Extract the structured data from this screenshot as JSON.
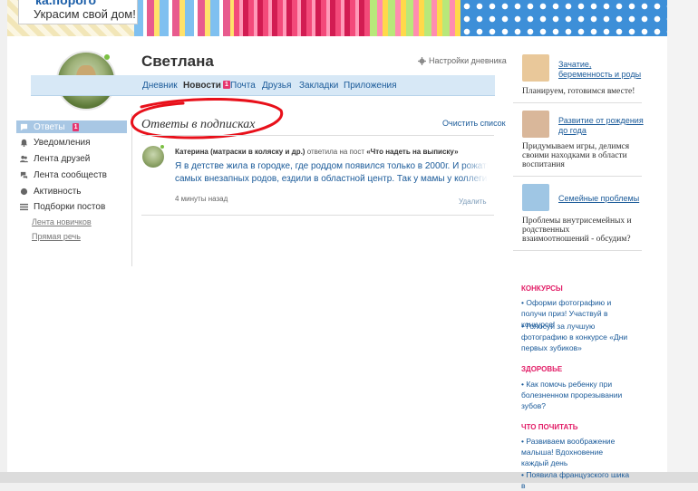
{
  "header": {
    "logo_top": "ка.порого",
    "slogan": "Украсим свой дом!"
  },
  "user": {
    "name": "Светлана",
    "settings_label": "Настройки дневника"
  },
  "tabs": [
    {
      "label": "Дневник",
      "active": false
    },
    {
      "label": "Новости",
      "active": true,
      "badge": "1"
    },
    {
      "label": "Почта",
      "active": false
    },
    {
      "label": "Друзья",
      "active": false
    },
    {
      "label": "Закладки",
      "active": false
    },
    {
      "label": "Приложения",
      "active": false
    }
  ],
  "sidebar": {
    "items": [
      {
        "label": "Ответы",
        "badge": "1",
        "icon": "speech-bubble-icon",
        "active": true
      },
      {
        "label": "Уведомления",
        "icon": "bell-icon"
      },
      {
        "label": "Лента друзей",
        "icon": "people-icon"
      },
      {
        "label": "Лента сообществ",
        "icon": "chat-icon"
      },
      {
        "label": "Активность",
        "icon": "activity-dot-icon"
      },
      {
        "label": "Подборки постов",
        "icon": "list-icon"
      }
    ],
    "subitems": [
      "Лента новичков",
      "Прямая речь"
    ]
  },
  "main": {
    "section_title": "Ответы в подписках",
    "clear_list": "Очистить список",
    "comment": {
      "author": "Катерина (матраски в коляску и др.)",
      "action": " ответила на пост ",
      "post_title": "«Что надеть на выписку»",
      "line1": "Я в детстве жила в городке, где роддом появился только в 2000г. И рожать, ну кроме",
      "line2": "самых внезапных родов, ездили в областной центр. Так у мамы у коллеги ребенка не",
      "time": "4 минуты назад",
      "delete": "Удалить"
    }
  },
  "right_sidebar": {
    "featured": [
      {
        "link": "Зачатие, беременность и роды",
        "desc": "Планируем, готовимся вместе!",
        "thumb_color": "#e9c89a"
      },
      {
        "link": "Развитие от рождения до года",
        "desc": "Придумываем игры, делимся своими находками в области воспитания",
        "thumb_color": "#d9b79a"
      },
      {
        "link": "Семейные проблемы",
        "desc": "Проблемы внутрисемейных и родственных взаимоотношений - обсудим?",
        "thumb_color": "#9fc6e4"
      }
    ],
    "categories": [
      {
        "title": "КОНКУРСЫ",
        "links": [
          "• Оформи фотографию и получи приз! Участвуй в конкурсе!",
          "• Голосуй за лучшую фотографию в конкурсе «Дни первых зубиков»"
        ]
      },
      {
        "title": "ЗДОРОВЬЕ",
        "links": [
          "• Как помочь ребенку при болезненном прорезывании зубов?"
        ]
      },
      {
        "title": "ЧТО ПОЧИТАТЬ",
        "links": [
          "• Развиваем воображение малыша! Вдохновение каждый день",
          "• Появила французского шика в"
        ]
      }
    ]
  },
  "colors": {
    "link": "#1a5a99",
    "accent_pink": "#e6356f",
    "tab_bar": "#d7e8f6",
    "active_menu": "#a8c7e4",
    "annotation_red": "#e8101a"
  }
}
